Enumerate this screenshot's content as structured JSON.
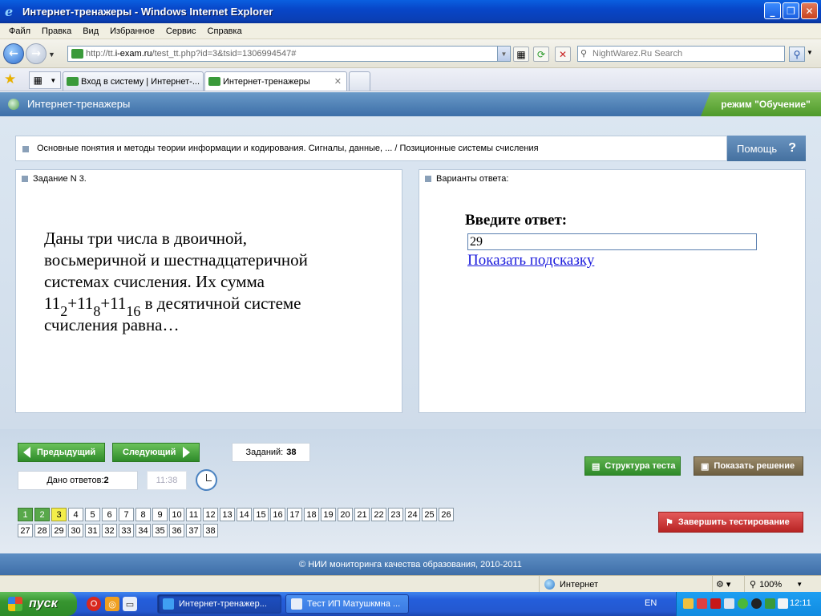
{
  "window": {
    "title": "Интернет-тренажеры - Windows Internet Explorer",
    "buttons": {
      "minimize": "_",
      "maximize": "❐",
      "close": "✕"
    }
  },
  "menu": [
    "Файл",
    "Правка",
    "Вид",
    "Избранное",
    "Сервис",
    "Справка"
  ],
  "address": {
    "url_prefix": "http://tt.",
    "url_host": "i-exam.ru",
    "url_path": "/test_tt.php?id=3&tsid=1306994547#",
    "search_placeholder": "NightWarez.Ru Search"
  },
  "tabs": [
    {
      "label": "Вход в систему | Интернет-..."
    },
    {
      "label": "Интернет-тренажеры"
    }
  ],
  "app": {
    "title": "Интернет-тренажеры",
    "mode": "режим \"Обучение\""
  },
  "breadcrumb": "Основные понятия и методы теории информации и кодирования. Сигналы, данные, ... / Позиционные системы счисления",
  "help_label": "Помощь",
  "help_glyph": "?",
  "task": {
    "header": "Задание N 3.",
    "text_line1": "Даны три числа в двоичной,",
    "text_line2": "восьмеричной и шестнадцатеричной",
    "text_line3": "системах счисления. Их сумма",
    "num1": "11",
    "sub1": "2",
    "plus1": "+11",
    "sub2": "8",
    "plus2": "+11",
    "sub3": "16",
    "text_line4_tail": " в десятичной системе",
    "text_line5": "счисления равна…"
  },
  "answer": {
    "header": "Варианты ответа:",
    "label": "Введите ответ:",
    "value": "29",
    "hint_link": "Показать подсказку"
  },
  "nav": {
    "prev_label": "Предыдущий",
    "next_label": "Следующий",
    "tasks_label": "Заданий:",
    "tasks_count": "38",
    "answered_label": "Дано ответов:",
    "answered_count": "2",
    "timer": "11:38",
    "structure_label": "Структура теста",
    "solution_label": "Показать решение",
    "finish_label": "Завершить тестирование"
  },
  "questions": {
    "row1": [
      "1",
      "2",
      "3",
      "4",
      "5",
      "6",
      "7",
      "8",
      "9",
      "10",
      "11",
      "12",
      "13",
      "14",
      "15",
      "16",
      "17",
      "18",
      "19",
      "20",
      "21",
      "22",
      "23",
      "24",
      "25",
      "26"
    ],
    "row2": [
      "27",
      "28",
      "29",
      "30",
      "31",
      "32",
      "33",
      "34",
      "35",
      "36",
      "37",
      "38"
    ],
    "done": [
      "1",
      "2"
    ],
    "current": "3"
  },
  "footer": "© НИИ мониторинга качества образования, 2010-2011",
  "status": {
    "zone": "Интернет",
    "zoom": "100%"
  },
  "taskbar": {
    "start": "пуск",
    "items": [
      "Интернет-тренажер...",
      "Тест ИП Матушкмна ..."
    ],
    "lang": "EN",
    "clock": "12:11"
  },
  "colors": {
    "done": "#58a84a",
    "current": "#f3ee4a",
    "accent": "#3d6fa8"
  }
}
